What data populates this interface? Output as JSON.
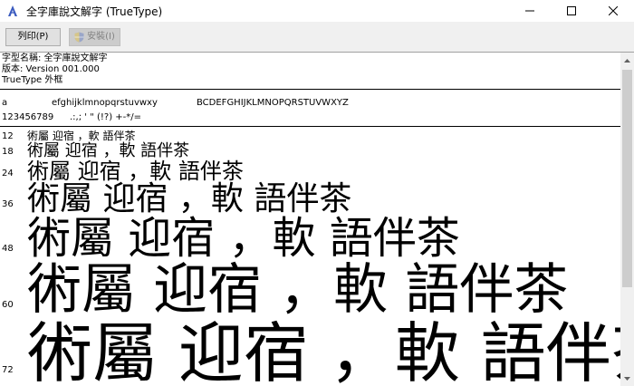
{
  "window": {
    "title": "全字庫說文解字 (TrueType)"
  },
  "toolbar": {
    "print_label": "列印(P)",
    "install_label": "安裝(I)"
  },
  "info": {
    "font_name": "字型名稱: 全字庫說文解字",
    "version": "版本: Version 001.000",
    "type": "TrueType 外框"
  },
  "charset": {
    "lowercase_a": "a",
    "lowercase_rest": "efghijklmnopqrstuvwxy",
    "uppercase": "BCDEFGHIJKLMNOPQRSTUVWXYZ",
    "digits": "123456789",
    "punctuation": ".:,; ' \" (!?) +-*/="
  },
  "samples": [
    {
      "size": "12",
      "text": "術屬 迎宿 ，軟 語伴茶"
    },
    {
      "size": "18",
      "text": "術屬 迎宿 ，軟 語伴茶"
    },
    {
      "size": "24",
      "text": "術屬 迎宿 ，軟 語伴茶"
    },
    {
      "size": "36",
      "text": "術屬 迎宿 ，軟 語伴茶"
    },
    {
      "size": "48",
      "text": "術屬 迎宿 ，軟 語伴茶"
    },
    {
      "size": "60",
      "text": "術屬 迎宿 ，軟 語伴茶"
    },
    {
      "size": "72",
      "text": "術屬 迎宿 ，軟 語伴茶"
    }
  ],
  "colors": {
    "toolbar_bg": "#f0f0f0",
    "disabled_text": "#838383"
  }
}
